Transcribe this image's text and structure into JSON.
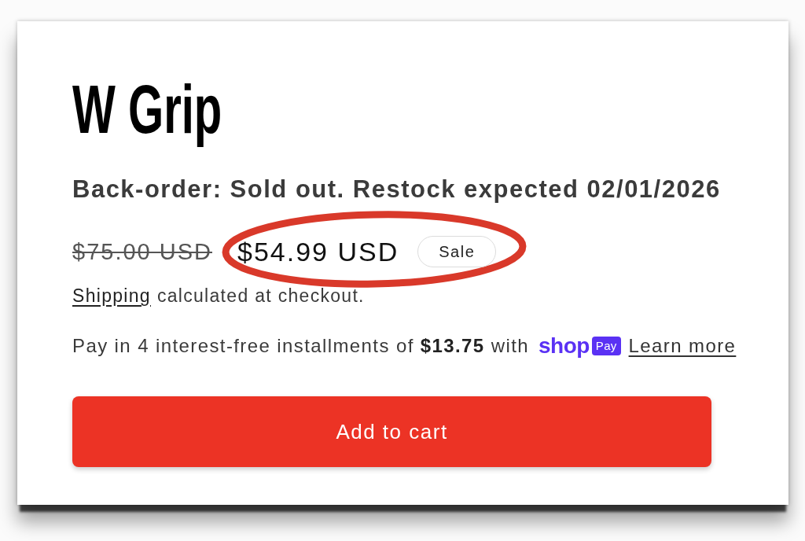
{
  "product": {
    "title": "W Grip",
    "availability": "Back-order: Sold out. Restock expected 02/01/2026"
  },
  "price": {
    "regular": "$75.00 USD",
    "sale": "$54.99 USD",
    "badge": "Sale",
    "on_sale": true
  },
  "shipping": {
    "link": "Shipping",
    "text": "calculated at checkout."
  },
  "installments": {
    "text": "Pay in 4 interest-free installments of **$13.75** with",
    "brand_word": "shop",
    "brand_tag": "Pay",
    "link": "Learn more"
  },
  "buttons": [
    {
      "label": "Add to cart",
      "kind": "primary"
    }
  ]
}
